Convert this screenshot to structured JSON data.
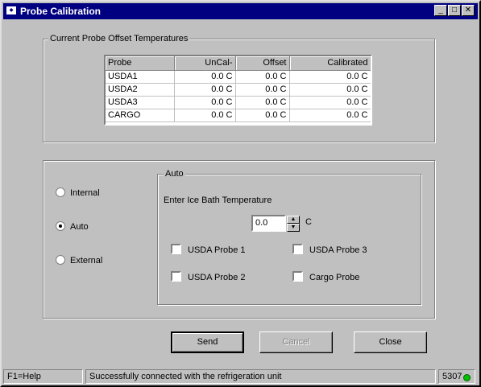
{
  "window": {
    "title": "Probe Calibration",
    "app_icon": "carrier-logo-icon"
  },
  "offsets_group": {
    "label": "Current Probe Offset Temperatures",
    "columns": [
      "Probe",
      "UnCal-",
      "Offset",
      "Calibrated"
    ],
    "rows": [
      [
        "USDA1",
        "0.0 C",
        "0.0 C",
        "0.0 C"
      ],
      [
        "USDA2",
        "0.0 C",
        "0.0 C",
        "0.0 C"
      ],
      [
        "USDA3",
        "0.0 C",
        "0.0 C",
        "0.0 C"
      ],
      [
        "CARGO",
        "0.0 C",
        "0.0 C",
        "0.0 C"
      ]
    ]
  },
  "mode": {
    "options": [
      "Internal",
      "Auto",
      "External"
    ],
    "selected": "Auto"
  },
  "auto_group": {
    "label": "Auto",
    "ice_bath_label": "Enter Ice Bath Temperature",
    "ice_bath_value": "0.0",
    "unit": "C",
    "checkboxes": [
      "USDA Probe 1",
      "USDA Probe 3",
      "USDA Probe 2",
      "Cargo Probe"
    ]
  },
  "buttons": {
    "send": "Send",
    "cancel": "Cancel",
    "close": "Close"
  },
  "status": {
    "help": "F1=Help",
    "message": "Successfully connected with the refrigeration unit",
    "code": "5307",
    "led_color": "#00c000"
  }
}
